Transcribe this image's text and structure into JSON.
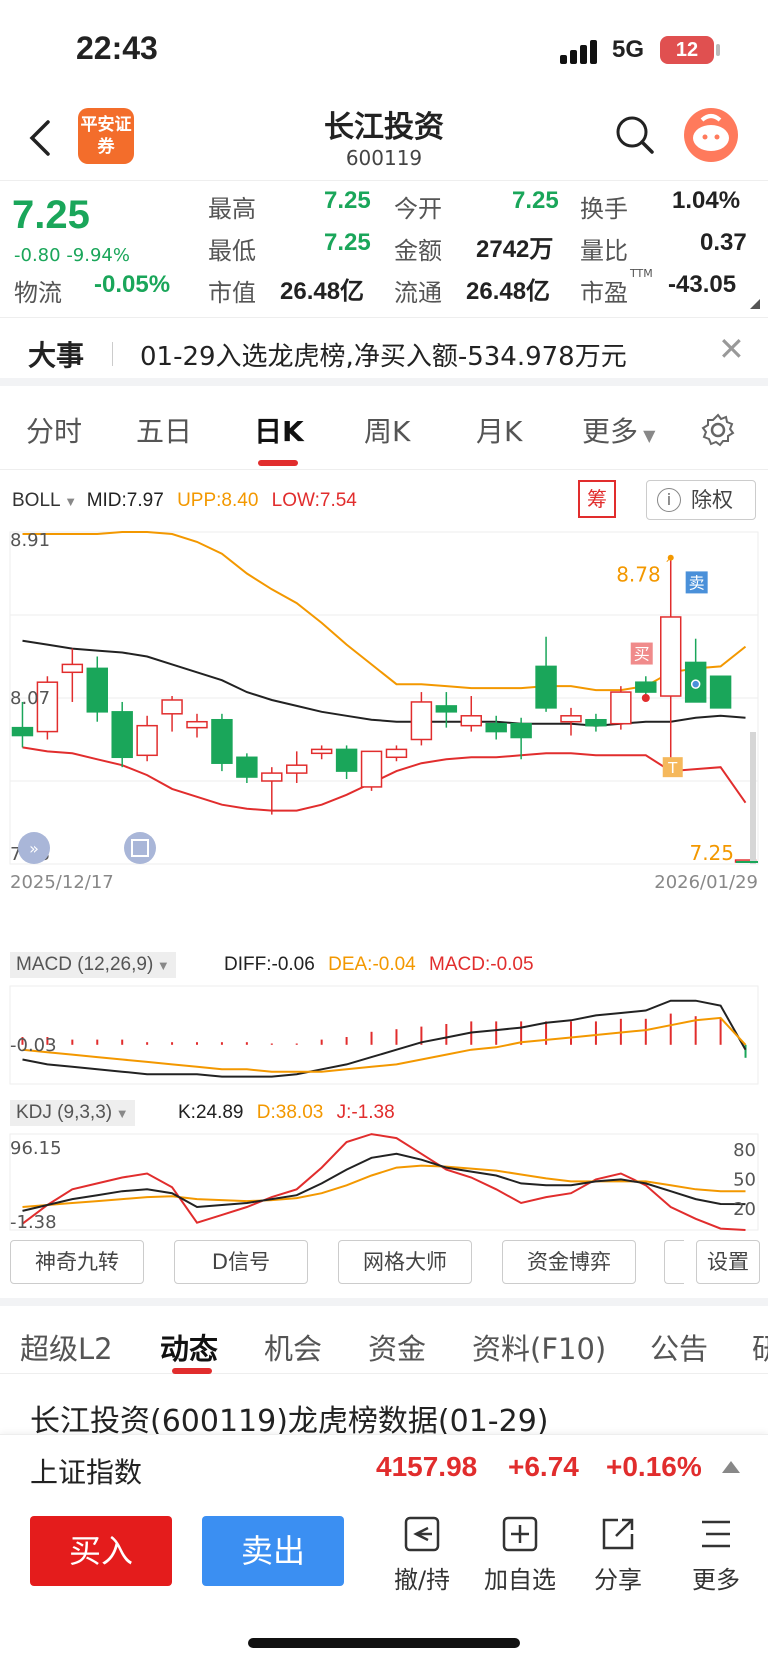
{
  "status_bar": {
    "time": "22:43",
    "network": "5G",
    "battery": "12"
  },
  "header": {
    "title": "长江投资",
    "code": "600119",
    "broker_logo": "平安证券"
  },
  "quote": {
    "price": "7.25",
    "change": "-0.80",
    "change_pct": "-9.94%",
    "high_label": "最高",
    "high": "7.25",
    "low_label": "最低",
    "low": "7.25",
    "open_label": "今开",
    "open": "7.25",
    "amount_label": "金额",
    "amount": "2742万",
    "turnover_label": "换手",
    "turnover": "1.04%",
    "volume_ratio_label": "量比",
    "volume_ratio": "0.37",
    "sector_label": "物流",
    "sector_change": "-0.05%",
    "mktcap_label": "市值",
    "mktcap": "26.48亿",
    "float_label": "流通",
    "float_cap": "26.48亿",
    "pe_label": "市盈",
    "pe_sup": "TTM",
    "pe": "-43.05"
  },
  "news": {
    "tag": "大事",
    "text": "01-29入选龙虎榜,净买入额-534.978万元"
  },
  "chart_tabs": [
    {
      "label": "分时"
    },
    {
      "label": "五日"
    },
    {
      "label": "日K"
    },
    {
      "label": "周K"
    },
    {
      "label": "月K"
    },
    {
      "label": "更多"
    }
  ],
  "boll": {
    "name": "BOLL",
    "mid": "MID:7.97",
    "upp": "UPP:8.40",
    "low": "LOW:7.54",
    "chou_label": "筹",
    "chuquan_label": "除权"
  },
  "chart_data": {
    "type": "candlestick",
    "x_start_label": "2025/12/17",
    "x_end_label": "2026/01/29",
    "y_top_label": "8.91",
    "y_mid_label": "8.07",
    "y_bottom_label": "7.23",
    "max_label": "8.78",
    "last_price_label": "7.25",
    "buy_marker": "买",
    "sell_marker": "卖",
    "t_marker": "T",
    "ylim": [
      7.23,
      8.91
    ],
    "candles": [
      {
        "o": 7.92,
        "h": 8.05,
        "l": 7.82,
        "c": 7.88
      },
      {
        "o": 7.9,
        "h": 8.18,
        "l": 7.86,
        "c": 8.15
      },
      {
        "o": 8.2,
        "h": 8.32,
        "l": 8.05,
        "c": 8.24
      },
      {
        "o": 8.22,
        "h": 8.28,
        "l": 7.95,
        "c": 8.0
      },
      {
        "o": 8.0,
        "h": 8.05,
        "l": 7.72,
        "c": 7.77
      },
      {
        "o": 7.78,
        "h": 7.98,
        "l": 7.75,
        "c": 7.93
      },
      {
        "o": 7.99,
        "h": 8.08,
        "l": 7.9,
        "c": 8.06
      },
      {
        "o": 7.92,
        "h": 7.99,
        "l": 7.87,
        "c": 7.95
      },
      {
        "o": 7.96,
        "h": 7.99,
        "l": 7.7,
        "c": 7.74
      },
      {
        "o": 7.77,
        "h": 7.79,
        "l": 7.64,
        "c": 7.67
      },
      {
        "o": 7.65,
        "h": 7.72,
        "l": 7.48,
        "c": 7.69
      },
      {
        "o": 7.69,
        "h": 7.8,
        "l": 7.64,
        "c": 7.73
      },
      {
        "o": 7.79,
        "h": 7.83,
        "l": 7.76,
        "c": 7.81
      },
      {
        "o": 7.81,
        "h": 7.83,
        "l": 7.66,
        "c": 7.7
      },
      {
        "o": 7.62,
        "h": 7.78,
        "l": 7.6,
        "c": 7.8
      },
      {
        "o": 7.77,
        "h": 7.83,
        "l": 7.75,
        "c": 7.81
      },
      {
        "o": 7.86,
        "h": 8.1,
        "l": 7.83,
        "c": 8.05
      },
      {
        "o": 8.03,
        "h": 8.1,
        "l": 7.92,
        "c": 8.0
      },
      {
        "o": 7.93,
        "h": 8.08,
        "l": 7.9,
        "c": 7.98
      },
      {
        "o": 7.94,
        "h": 7.98,
        "l": 7.86,
        "c": 7.9
      },
      {
        "o": 7.94,
        "h": 7.97,
        "l": 7.76,
        "c": 7.87
      },
      {
        "o": 8.23,
        "h": 8.38,
        "l": 8.0,
        "c": 8.02
      },
      {
        "o": 7.95,
        "h": 8.02,
        "l": 7.88,
        "c": 7.98
      },
      {
        "o": 7.96,
        "h": 7.99,
        "l": 7.9,
        "c": 7.93
      },
      {
        "o": 7.94,
        "h": 8.13,
        "l": 7.91,
        "c": 8.1
      },
      {
        "o": 8.15,
        "h": 8.18,
        "l": 8.06,
        "c": 8.1
      },
      {
        "o": 8.08,
        "h": 8.78,
        "l": 7.76,
        "c": 8.48
      },
      {
        "o": 8.25,
        "h": 8.37,
        "l": 8.08,
        "c": 8.05
      },
      {
        "o": 8.18,
        "h": 8.18,
        "l": 8.02,
        "c": 8.02
      },
      {
        "o": 7.25,
        "h": 7.25,
        "l": 7.25,
        "c": 7.25
      }
    ],
    "series": [
      {
        "name": "MID",
        "values": [
          8.36,
          8.34,
          8.32,
          8.31,
          8.3,
          8.28,
          8.24,
          8.2,
          8.16,
          8.1,
          8.06,
          8.03,
          8.0,
          7.98,
          7.96,
          7.95,
          7.95,
          7.95,
          7.95,
          7.95,
          7.94,
          7.94,
          7.94,
          7.93,
          7.94,
          7.95,
          7.95,
          7.97,
          7.98,
          7.97
        ]
      },
      {
        "name": "UPP",
        "values": [
          8.9,
          8.9,
          8.9,
          8.9,
          8.91,
          8.91,
          8.9,
          8.86,
          8.8,
          8.7,
          8.62,
          8.55,
          8.45,
          8.34,
          8.24,
          8.14,
          8.14,
          8.13,
          8.12,
          8.12,
          8.12,
          8.13,
          8.13,
          8.11,
          8.11,
          8.13,
          8.2,
          8.22,
          8.23,
          8.33
        ]
      },
      {
        "name": "LOW",
        "values": [
          7.82,
          7.8,
          7.79,
          7.76,
          7.73,
          7.68,
          7.61,
          7.57,
          7.53,
          7.51,
          7.5,
          7.5,
          7.53,
          7.58,
          7.64,
          7.7,
          7.74,
          7.76,
          7.77,
          7.77,
          7.78,
          7.79,
          7.79,
          7.78,
          7.78,
          7.78,
          7.7,
          7.71,
          7.72,
          7.54
        ]
      }
    ]
  },
  "macd": {
    "name": "MACD (12,26,9)",
    "diff": "DIFF:-0.06",
    "dea": "DEA:-0.04",
    "macd": "MACD:-0.05",
    "axis_label": "-0.03",
    "hist": [
      0.03,
      0.03,
      0.02,
      0.02,
      0.02,
      0.01,
      0.01,
      0.01,
      0.01,
      0.01,
      0.005,
      0.005,
      0.02,
      0.03,
      0.05,
      0.06,
      0.07,
      0.08,
      0.09,
      0.09,
      0.09,
      0.09,
      0.09,
      0.09,
      0.1,
      0.1,
      0.12,
      0.11,
      0.1,
      -0.05
    ],
    "diff_series": [
      -0.1,
      -0.12,
      -0.13,
      -0.14,
      -0.15,
      -0.16,
      -0.16,
      -0.16,
      -0.17,
      -0.17,
      -0.17,
      -0.16,
      -0.14,
      -0.12,
      -0.09,
      -0.06,
      -0.03,
      -0.01,
      0.01,
      0.02,
      0.03,
      0.05,
      0.06,
      0.08,
      0.09,
      0.1,
      0.14,
      0.14,
      0.12,
      -0.06
    ],
    "dea_series": [
      -0.06,
      -0.07,
      -0.08,
      -0.09,
      -0.1,
      -0.11,
      -0.12,
      -0.13,
      -0.14,
      -0.14,
      -0.15,
      -0.15,
      -0.15,
      -0.14,
      -0.13,
      -0.12,
      -0.1,
      -0.08,
      -0.06,
      -0.05,
      -0.03,
      -0.02,
      -0.01,
      0.0,
      0.01,
      0.02,
      0.04,
      0.06,
      0.07,
      -0.04
    ]
  },
  "kdj": {
    "name": "KDJ (9,3,3)",
    "k": "K:24.89",
    "d": "D:38.03",
    "j": "J:-1.38",
    "y_top_label": "96.15",
    "y_bottom_label": "-1.38",
    "r80": "80",
    "r50": "50",
    "r20": "20",
    "k_series": [
      18,
      24,
      30,
      34,
      38,
      40,
      36,
      22,
      24,
      26,
      30,
      34,
      46,
      60,
      72,
      76,
      70,
      62,
      58,
      54,
      46,
      44,
      44,
      48,
      50,
      46,
      38,
      30,
      25,
      24.89
    ],
    "d_series": [
      22,
      24,
      26,
      28,
      30,
      32,
      33,
      30,
      29,
      28,
      29,
      31,
      36,
      44,
      54,
      62,
      64,
      63,
      61,
      59,
      55,
      51,
      48,
      48,
      48,
      48,
      44,
      40,
      38,
      38.03
    ],
    "j_series": [
      5,
      24,
      40,
      46,
      52,
      56,
      42,
      6,
      14,
      22,
      32,
      40,
      62,
      88,
      96,
      92,
      76,
      60,
      52,
      40,
      26,
      32,
      36,
      50,
      56,
      44,
      22,
      10,
      0,
      -1.38
    ]
  },
  "tools": [
    {
      "label": "神奇九转"
    },
    {
      "label": "D信号"
    },
    {
      "label": "网格大师"
    },
    {
      "label": "资金博弈"
    },
    {
      "label": ""
    },
    {
      "label": "设置"
    }
  ],
  "bottom_tabs": [
    {
      "label": "超级L2"
    },
    {
      "label": "动态"
    },
    {
      "label": "机会"
    },
    {
      "label": "资金"
    },
    {
      "label": "资料(F10)"
    },
    {
      "label": "公告"
    },
    {
      "label": "研"
    }
  ],
  "headline": "长江投资(600119)龙虎榜数据(01-29)",
  "index": {
    "name": "上证指数",
    "value": "4157.98",
    "change": "+6.74",
    "pct": "+0.16%"
  },
  "actions": {
    "buy": "买入",
    "sell": "卖出",
    "cancel": "撤/持",
    "watch": "加自选",
    "share": "分享",
    "more": "更多"
  },
  "colors": {
    "up": "#e12d2d",
    "down": "#1aa65a",
    "accent": "#f39800"
  }
}
